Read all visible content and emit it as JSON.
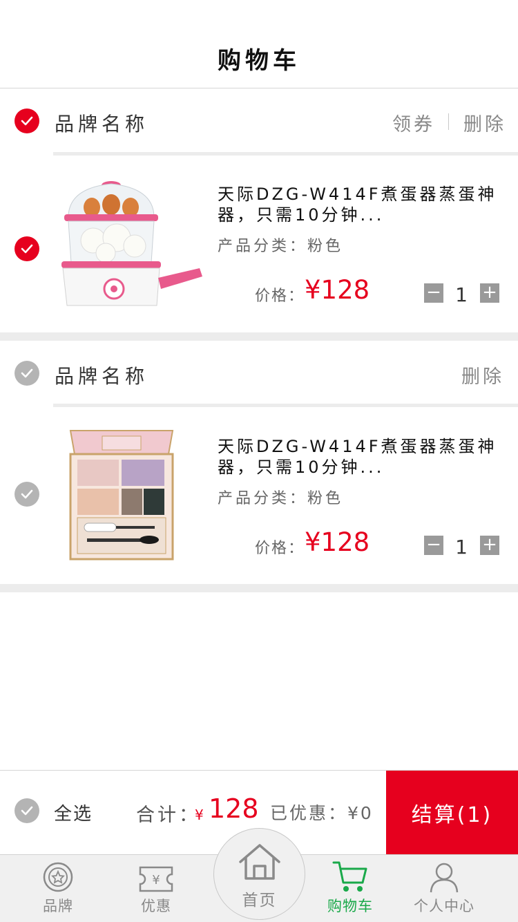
{
  "header": {
    "title": "购物车"
  },
  "shops": [
    {
      "name": "品牌名称",
      "selected": true,
      "actions": [
        "领券",
        "删除"
      ],
      "item": {
        "title": "天际DZG-W414F煮蛋器蒸蛋神器，只需10分钟...",
        "spec": "产品分类：粉色",
        "price_label": "价格：",
        "price_currency": "¥",
        "price": "128",
        "qty": "1",
        "qty_minus": "−",
        "qty_plus": "+",
        "image_icon": "egg-steamer-image",
        "selected": true
      }
    },
    {
      "name": "品牌名称",
      "selected": false,
      "actions": [
        "删除"
      ],
      "item": {
        "title": "天际DZG-W414F煮蛋器蒸蛋神器，只需10分钟...",
        "spec": "产品分类：粉色",
        "price_label": "价格：",
        "price_currency": "¥",
        "price": "128",
        "qty": "1",
        "qty_minus": "−",
        "qty_plus": "+",
        "image_icon": "eyeshadow-palette-image",
        "selected": false
      }
    }
  ],
  "footer": {
    "select_all": "全选",
    "total_label": "合计：",
    "total_currency": "¥",
    "total_value": "128",
    "discount_text": "已优惠：¥0",
    "checkout_label": "结算(1)"
  },
  "tabbar": {
    "brand": "品牌",
    "coupon": "优惠",
    "home": "首页",
    "cart": "购物车",
    "profile": "个人中心",
    "active": "cart"
  },
  "colors": {
    "accent": "#e6001e",
    "active_tab": "#1aa94a",
    "inactive": "#888888"
  }
}
